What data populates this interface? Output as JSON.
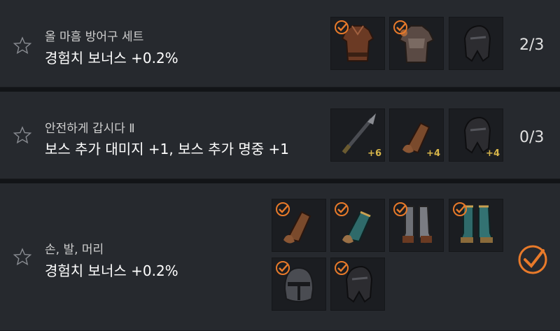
{
  "sets": [
    {
      "title": "올 마흠 방어구 세트",
      "bonus": "경험치 보너스 +0.2%",
      "progress": "2/3",
      "items": [
        {
          "icon": "leather-armor-icon",
          "checked": true,
          "level": ""
        },
        {
          "icon": "plate-armor-icon",
          "checked": true,
          "level": ""
        },
        {
          "icon": "dark-helmet-icon",
          "checked": false,
          "level": ""
        }
      ]
    },
    {
      "title": "안전하게 갑시다 Ⅱ",
      "bonus": "보스 추가 대미지 +1, 보스 추가 명중 +1",
      "progress": "0/3",
      "items": [
        {
          "icon": "spear-icon",
          "checked": false,
          "level": "+6"
        },
        {
          "icon": "leather-gauntlet-icon",
          "checked": false,
          "level": "+4"
        },
        {
          "icon": "dark-helmet-icon",
          "checked": false,
          "level": "+4"
        }
      ]
    },
    {
      "title": "손, 발, 머리",
      "bonus": "경험치 보너스 +0.2%",
      "completed": true,
      "items": [
        {
          "icon": "leather-gauntlet-icon",
          "checked": true,
          "level": ""
        },
        {
          "icon": "teal-gauntlet-icon",
          "checked": true,
          "level": ""
        },
        {
          "icon": "steel-greaves-icon",
          "checked": true,
          "level": ""
        },
        {
          "icon": "teal-greaves-icon",
          "checked": true,
          "level": ""
        },
        {
          "icon": "steel-helmet-icon",
          "checked": true,
          "level": ""
        },
        {
          "icon": "dark-helmet-icon",
          "checked": true,
          "level": ""
        }
      ]
    }
  ],
  "colors": {
    "check": "#e87a2a",
    "level": "#d8b64a",
    "row_bg": "#26292e"
  }
}
